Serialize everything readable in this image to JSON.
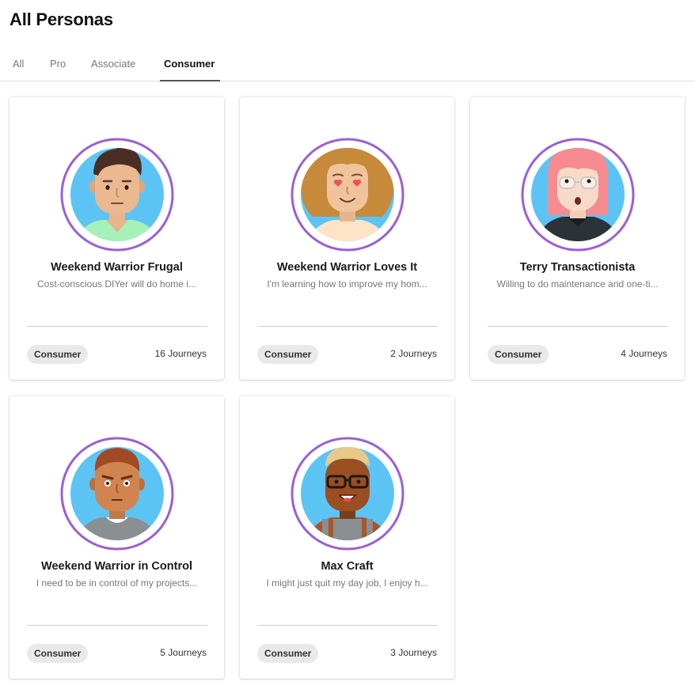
{
  "page": {
    "title": "All Personas"
  },
  "tabs": [
    {
      "label": "All",
      "active": false
    },
    {
      "label": "Pro",
      "active": false
    },
    {
      "label": "Associate",
      "active": false
    },
    {
      "label": "Consumer",
      "active": true
    }
  ],
  "colors": {
    "avatar_ring": "#9b5fd6",
    "avatar_background": "#5cc4f5",
    "badge_background": "#e9e9e9",
    "active_tab_underline": "#555555"
  },
  "personas": [
    {
      "name": "Weekend Warrior Frugal",
      "description": "Cost-conscious DIYer will do home i...",
      "badge": "Consumer",
      "journeys": "16 Journeys",
      "avatar_icon": "man-brown-hair-avatar-icon"
    },
    {
      "name": "Weekend Warrior Loves It",
      "description": "I'm learning how to improve my hom...",
      "badge": "Consumer",
      "journeys": "2 Journeys",
      "avatar_icon": "woman-heart-eyes-avatar-icon"
    },
    {
      "name": "Terry Transactionista",
      "description": "Willing to do maintenance and one-ti...",
      "badge": "Consumer",
      "journeys": "4 Journeys",
      "avatar_icon": "woman-pink-hair-glasses-avatar-icon"
    },
    {
      "name": "Weekend Warrior in Control",
      "description": "I need to be in control of my projects...",
      "badge": "Consumer",
      "journeys": "5 Journeys",
      "avatar_icon": "man-auburn-hair-avatar-icon"
    },
    {
      "name": "Max Craft",
      "description": "I might just quit my day job, I enjoy h...",
      "badge": "Consumer",
      "journeys": "3 Journeys",
      "avatar_icon": "man-glasses-overalls-avatar-icon"
    }
  ]
}
